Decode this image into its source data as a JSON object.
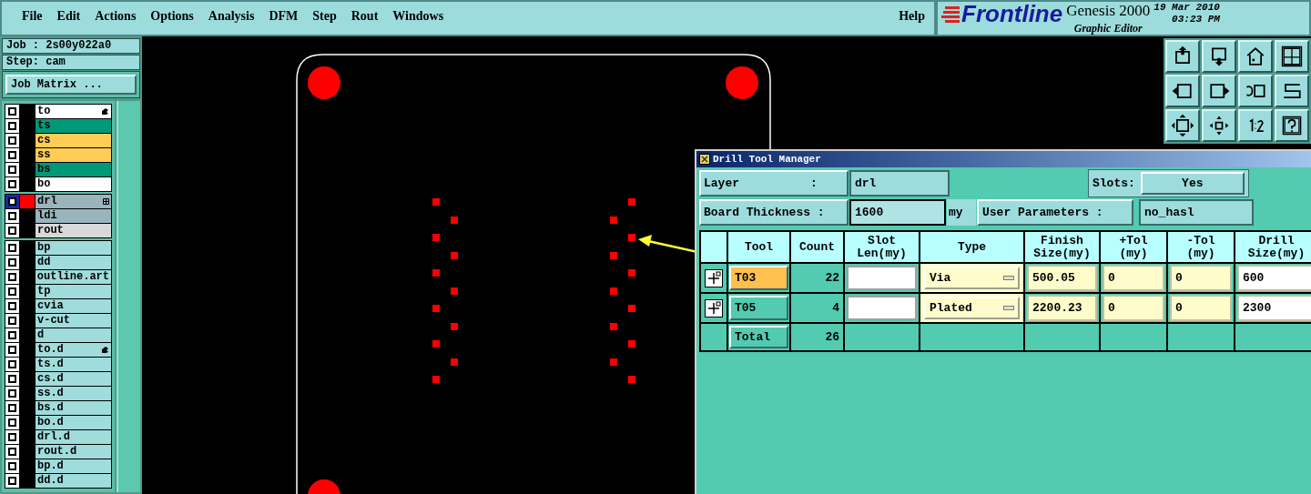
{
  "menu": [
    "File",
    "Edit",
    "Actions",
    "Options",
    "Analysis",
    "DFM",
    "Step",
    "Rout",
    "Windows"
  ],
  "help": "Help",
  "brand": {
    "logo": "Frontline",
    "product": "Genesis 2000",
    "subtitle": "Graphic Editor",
    "date": "19 Mar 2010",
    "time": "03:23 PM"
  },
  "job": "Job : 2s00y022a0",
  "step": "Step: cam",
  "job_matrix_button": "Job Matrix ...",
  "layer_groups": [
    [
      {
        "name": "to",
        "color": "#ffffff",
        "marked": true,
        "selected": false
      },
      {
        "name": "ts",
        "color": "#009977",
        "marked": false,
        "selected": false
      },
      {
        "name": "cs",
        "color": "#ffcc55",
        "marked": false,
        "selected": false
      },
      {
        "name": "ss",
        "color": "#ffcc55",
        "marked": false,
        "selected": false
      },
      {
        "name": "bs",
        "color": "#009977",
        "marked": false,
        "selected": false
      },
      {
        "name": "bo",
        "color": "#ffffff",
        "marked": false,
        "selected": false
      }
    ],
    [
      {
        "name": "drl",
        "color": "#9ab4bc",
        "marked": false,
        "selected": true,
        "expand": true
      },
      {
        "name": "ldi",
        "color": "#9ab4bc",
        "marked": false,
        "selected": false
      },
      {
        "name": "rout",
        "color": "#d8d8d8",
        "marked": false,
        "selected": false
      }
    ],
    [
      {
        "name": "bp",
        "color": "#a0dcdc",
        "marked": false,
        "selected": false
      },
      {
        "name": "dd",
        "color": "#a0dcdc",
        "marked": false,
        "selected": false
      },
      {
        "name": "outline.art",
        "color": "#a0dcdc",
        "marked": false,
        "selected": false
      },
      {
        "name": "tp",
        "color": "#a0dcdc",
        "marked": false,
        "selected": false
      },
      {
        "name": "cvia",
        "color": "#a0dcdc",
        "marked": false,
        "selected": false
      },
      {
        "name": "v-cut",
        "color": "#a0dcdc",
        "marked": false,
        "selected": false
      },
      {
        "name": "d",
        "color": "#a0dcdc",
        "marked": false,
        "selected": false
      },
      {
        "name": "to.d",
        "color": "#a0dcdc",
        "marked": true,
        "selected": false
      },
      {
        "name": "ts.d",
        "color": "#a0dcdc",
        "marked": false,
        "selected": false
      },
      {
        "name": "cs.d",
        "color": "#a0dcdc",
        "marked": false,
        "selected": false
      },
      {
        "name": "ss.d",
        "color": "#a0dcdc",
        "marked": false,
        "selected": false
      },
      {
        "name": "bs.d",
        "color": "#a0dcdc",
        "marked": false,
        "selected": false
      },
      {
        "name": "bo.d",
        "color": "#a0dcdc",
        "marked": false,
        "selected": false
      },
      {
        "name": "drl.d",
        "color": "#a0dcdc",
        "marked": false,
        "selected": false
      },
      {
        "name": "rout.d",
        "color": "#a0dcdc",
        "marked": false,
        "selected": false
      },
      {
        "name": "bp.d",
        "color": "#a0dcdc",
        "marked": false,
        "selected": false
      },
      {
        "name": "dd.d",
        "color": "#a0dcdc",
        "marked": false,
        "selected": false
      }
    ]
  ],
  "dialog": {
    "title": "Drill Tool Manager",
    "layer_label": "Layer          :",
    "layer_value": "drl",
    "slots_label": "Slots:",
    "slots_value": "Yes",
    "thickness_label": "Board Thickness :",
    "thickness_value": "1600",
    "thickness_unit": "my",
    "user_params_label": "User Parameters :",
    "user_params_value": "no_hasl",
    "columns": [
      "Tool",
      "Count",
      "Slot\nLen(my)",
      "Type",
      "Finish\nSize(my)",
      "+Tol\n(my)",
      "-Tol\n(my)",
      "Drill\nSize(my)"
    ],
    "rows": [
      {
        "tool": "T03",
        "selected": true,
        "count": "22",
        "type": "Via",
        "finish": "500.05",
        "plus_tol": "0",
        "minus_tol": "0",
        "drill": "600"
      },
      {
        "tool": "T05",
        "selected": false,
        "count": "4",
        "type": "Plated",
        "finish": "2200.23",
        "plus_tol": "0",
        "minus_tol": "0",
        "drill": "2300"
      }
    ],
    "total_label": "Total",
    "total_count": "26"
  }
}
